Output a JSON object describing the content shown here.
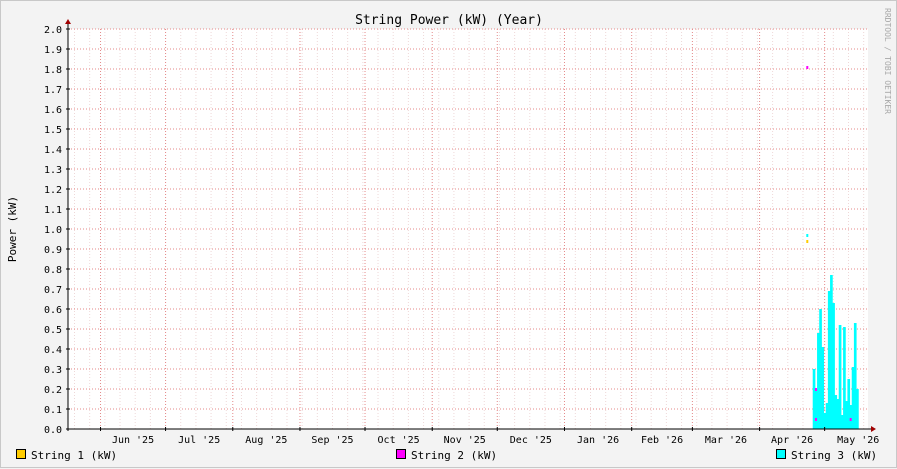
{
  "chart_data": {
    "type": "bar",
    "title": "String Power (kW) (Year)",
    "ylabel": "Power (kW)",
    "watermark": "RRDTOOL / TOBI OETIKER",
    "ylim": [
      0,
      2.0
    ],
    "y_ticks": [
      "0.0",
      "0.1",
      "0.2",
      "0.3",
      "0.4",
      "0.5",
      "0.6",
      "0.7",
      "0.8",
      "0.9",
      "1.0",
      "1.1",
      "1.2",
      "1.3",
      "1.4",
      "1.5",
      "1.6",
      "1.7",
      "1.8",
      "1.9",
      "2.0"
    ],
    "x_ticks": [
      {
        "label": "Jun '25",
        "date": "2025-06-01"
      },
      {
        "label": "Jul '25",
        "date": "2025-07-01"
      },
      {
        "label": "Aug '25",
        "date": "2025-08-01"
      },
      {
        "label": "Sep '25",
        "date": "2025-09-01"
      },
      {
        "label": "Oct '25",
        "date": "2025-10-01"
      },
      {
        "label": "Nov '25",
        "date": "2025-11-01"
      },
      {
        "label": "Dec '25",
        "date": "2025-12-01"
      },
      {
        "label": "Jan '26",
        "date": "2026-01-01"
      },
      {
        "label": "Feb '26",
        "date": "2026-02-01"
      },
      {
        "label": "Mar '26",
        "date": "2026-03-01"
      },
      {
        "label": "Apr '26",
        "date": "2026-04-01"
      },
      {
        "label": "May '26",
        "date": "2026-05-01"
      }
    ],
    "xlim": [
      "2025-05-17",
      "2026-05-21"
    ],
    "grid": true,
    "legend_position": "bottom",
    "series": [
      {
        "name": "String 1 (kW)",
        "color": "#ffcc00",
        "points": [
          {
            "date": "2026-04-23",
            "value": 0.94
          }
        ]
      },
      {
        "name": "String 2 (kW)",
        "color": "#ff00ff",
        "points": [
          {
            "date": "2026-04-23",
            "value": 1.81
          },
          {
            "date": "2026-04-27",
            "value": 0.2
          },
          {
            "date": "2026-04-27",
            "value": 0.05
          },
          {
            "date": "2026-05-13",
            "value": 0.05
          }
        ]
      },
      {
        "name": "String 3 (kW)",
        "color": "#00ffff",
        "points": [
          {
            "date": "2026-04-23",
            "value": 0.97
          },
          {
            "date": "2026-04-26",
            "value": 0.3
          },
          {
            "date": "2026-04-27",
            "value": 0.2
          },
          {
            "date": "2026-04-28",
            "value": 0.48
          },
          {
            "date": "2026-04-29",
            "value": 0.6
          },
          {
            "date": "2026-04-30",
            "value": 0.41
          },
          {
            "date": "2026-05-01",
            "value": 0.08
          },
          {
            "date": "2026-05-02",
            "value": 0.13
          },
          {
            "date": "2026-05-03",
            "value": 0.69
          },
          {
            "date": "2026-05-04",
            "value": 0.77
          },
          {
            "date": "2026-05-05",
            "value": 0.63
          },
          {
            "date": "2026-05-06",
            "value": 0.17
          },
          {
            "date": "2026-05-07",
            "value": 0.15
          },
          {
            "date": "2026-05-08",
            "value": 0.52
          },
          {
            "date": "2026-05-09",
            "value": 0.07
          },
          {
            "date": "2026-05-10",
            "value": 0.51
          },
          {
            "date": "2026-05-11",
            "value": 0.14
          },
          {
            "date": "2026-05-12",
            "value": 0.25
          },
          {
            "date": "2026-05-13",
            "value": 0.12
          },
          {
            "date": "2026-05-14",
            "value": 0.31
          },
          {
            "date": "2026-05-15",
            "value": 0.53
          },
          {
            "date": "2026-05-16",
            "value": 0.2
          }
        ]
      }
    ]
  }
}
